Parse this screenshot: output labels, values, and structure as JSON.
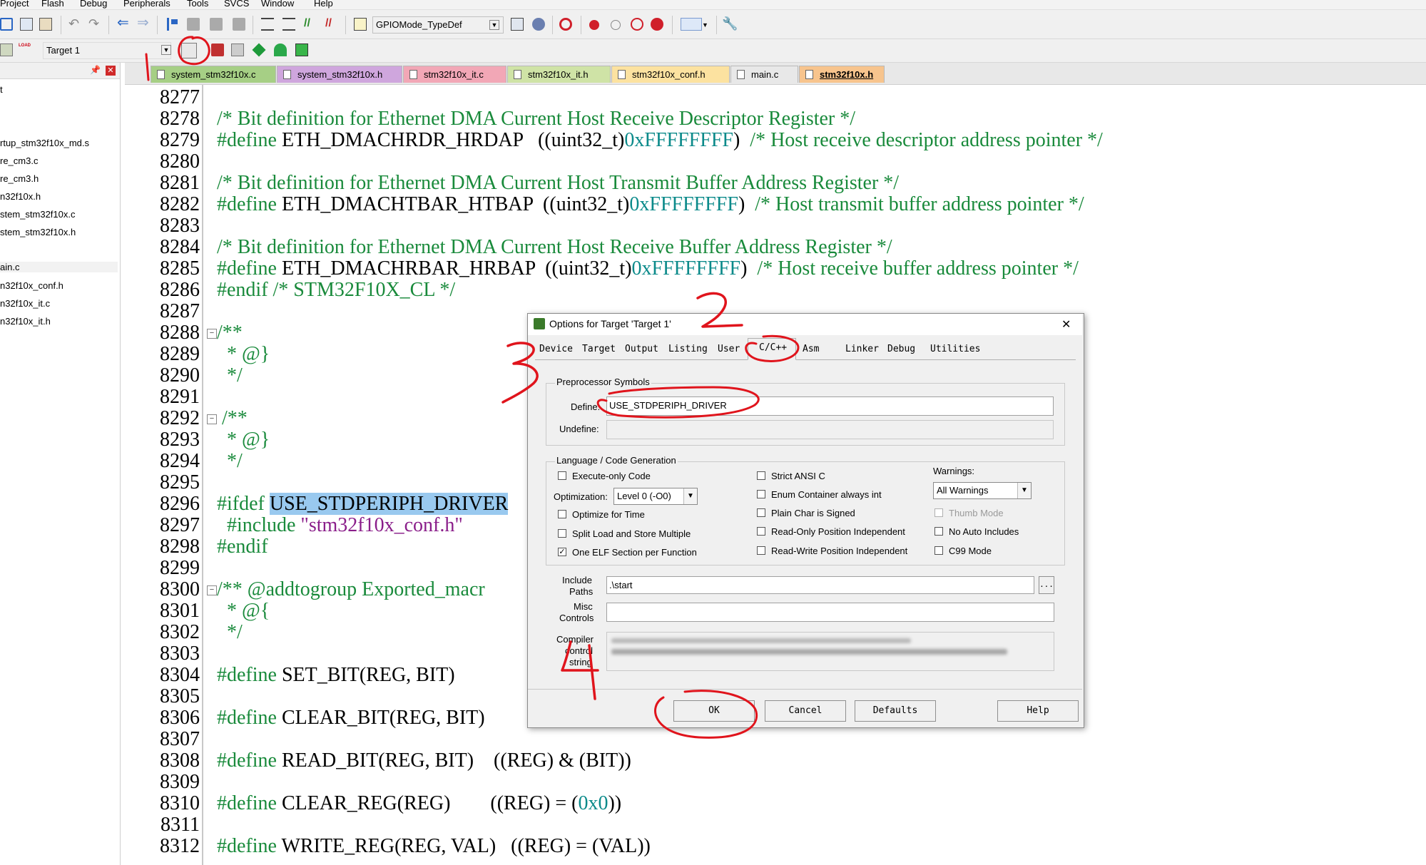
{
  "menubar": {
    "items": [
      "Project",
      "Flash",
      "Debug",
      "Peripherals",
      "Tools",
      "SVCS",
      "Window",
      "Help"
    ]
  },
  "toolbar": {
    "find_combo": "GPIOMode_TypeDef",
    "target_combo": "Target 1",
    "load_label": "LOAD"
  },
  "project_panel": {
    "items": [
      "t",
      "rtup_stm32f10x_md.s",
      "re_cm3.c",
      "re_cm3.h",
      "n32f10x.h",
      "stem_stm32f10x.c",
      "stem_stm32f10x.h",
      "ain.c",
      "n32f10x_conf.h",
      "n32f10x_it.c",
      "n32f10x_it.h"
    ]
  },
  "tabs": [
    {
      "label": "system_stm32f10x.c",
      "color": "#a6cf85"
    },
    {
      "label": "system_stm32f10x.h",
      "color": "#cfa6dd"
    },
    {
      "label": "stm32f10x_it.c",
      "color": "#f2a7b6"
    },
    {
      "label": "stm32f10x_it.h",
      "color": "#cfe3a6"
    },
    {
      "label": "stm32f10x_conf.h",
      "color": "#fce2a0"
    },
    {
      "label": "main.c",
      "color": "#e8e8e8"
    },
    {
      "label": "stm32f10x.h",
      "color": "#f7c48d"
    }
  ],
  "editor": {
    "line_numbers": [
      "8277",
      "8278",
      "8279",
      "8280",
      "8281",
      "8282",
      "8283",
      "8284",
      "8285",
      "8286",
      "8287",
      "8288",
      "8289",
      "8290",
      "8291",
      "8292",
      "8293",
      "8294",
      "8295",
      "8296",
      "8297",
      "8298",
      "8299",
      "8300",
      "8301",
      "8302",
      "8303",
      "8304",
      "8305",
      "8306",
      "8307",
      "8308",
      "8309",
      "8310",
      "8311",
      "8312"
    ],
    "c8278": "/* Bit definition for Ethernet DMA Current Host Receive Descriptor Register */",
    "c8279_a": "#define",
    "c8279_b": " ETH_DMACHRDR_HRDAP   ((uint32_t)",
    "c8279_c": "0xFFFFFFFF",
    "c8279_d": ")",
    "c8279_e": "  /* Host receive descriptor address pointer */",
    "c8281": "/* Bit definition for Ethernet DMA Current Host Transmit Buffer Address Register */",
    "c8282_a": "#define",
    "c8282_b": " ETH_DMACHTBAR_HTBAP  ((uint32_t)",
    "c8282_c": "0xFFFFFFFF",
    "c8282_d": ")",
    "c8282_e": "  /* Host transmit buffer address pointer */",
    "c8284": "/* Bit definition for Ethernet DMA Current Host Receive Buffer Address Register */",
    "c8285_a": "#define",
    "c8285_b": " ETH_DMACHRBAR_HRBAP  ((uint32_t)",
    "c8285_c": "0xFFFFFFFF",
    "c8285_d": ")",
    "c8285_e": "  /* Host receive buffer address pointer */",
    "c8286": "#endif /* STM32F10X_CL */",
    "c8288": "/**",
    "c8289": "  * @}",
    "c8290": "  */",
    "c8292": " /**",
    "c8293": "  * @}",
    "c8294": "  */",
    "c8296_a": "#ifdef ",
    "c8296_b": "USE_STDPERIPH_DRIVER",
    "c8297_a": "  #include ",
    "c8297_b": "\"stm32f10x_conf.h\"",
    "c8298": "#endif",
    "c8300": "/** @addtogroup Exported_macr",
    "c8301": "  * @{",
    "c8302": "  */",
    "c8304_a": "#define",
    "c8304_b": " SET_BIT(REG, BIT)",
    "c8306_a": "#define",
    "c8306_b": " CLEAR_BIT(REG, BIT)",
    "c8308_a": "#define",
    "c8308_b": " READ_BIT(REG, BIT)    ((REG) & (BIT))",
    "c8310_a": "#define",
    "c8310_b": " CLEAR_REG(REG)        ((REG) = (",
    "c8310_c": "0x0",
    "c8310_d": "))",
    "c8312_a": "#define",
    "c8312_b": " WRITE_REG(REG, VAL)   ((REG) = (VAL))"
  },
  "dialog": {
    "title": "Options for Target 'Target 1'",
    "close": "✕",
    "tabs": [
      "Device",
      "Target",
      "Output",
      "Listing",
      "User",
      "C/C++",
      "Asm",
      "Linker",
      "Debug",
      "Utilities"
    ],
    "active_tab": "C/C++",
    "preprocessor": {
      "group": "Preprocessor Symbols",
      "define_label": "Define:",
      "define_value": "USE_STDPERIPH_DRIVER",
      "undefine_label": "Undefine:",
      "undefine_value": ""
    },
    "language": {
      "group": "Language / Code Generation",
      "execute_only": "Execute-only Code",
      "optimization_label": "Optimization:",
      "optimization_value": "Level 0 (-O0)",
      "optimize_time": "Optimize for Time",
      "split_load": "Split Load and Store Multiple",
      "one_elf": "One ELF Section per Function",
      "strict_ansi": "Strict ANSI C",
      "enum_container": "Enum Container always int",
      "plain_char": "Plain Char is Signed",
      "ro_pi": "Read-Only Position Independent",
      "rw_pi": "Read-Write Position Independent",
      "warnings_label": "Warnings:",
      "warnings_value": "All Warnings",
      "thumb_mode": "Thumb Mode",
      "no_auto": "No Auto Includes",
      "c99": "C99 Mode"
    },
    "include_paths_label_1": "Include",
    "include_paths_label_2": "Paths",
    "include_paths_value": ".\\start",
    "browse": "...",
    "misc_label_1": "Misc",
    "misc_label_2": "Controls",
    "misc_value": "",
    "compiler_label_1": "Compiler",
    "compiler_label_2": "control",
    "compiler_label_3": "string",
    "buttons": {
      "ok": "OK",
      "cancel": "Cancel",
      "defaults": "Defaults",
      "help": "Help"
    }
  },
  "annotations": {
    "n2": "2",
    "n3": "3",
    "n4": "4"
  }
}
